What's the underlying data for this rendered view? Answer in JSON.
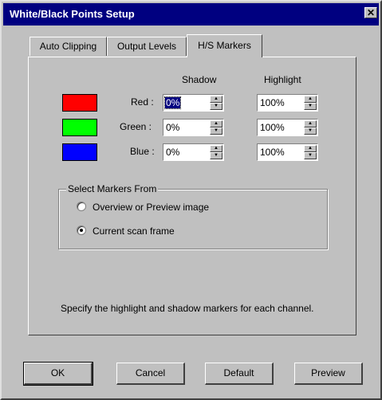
{
  "window": {
    "title": "White/Black Points Setup",
    "close_glyph": "✕"
  },
  "tabs": [
    "Auto Clipping",
    "Output Levels",
    "H/S Markers"
  ],
  "active_tab": "H/S Markers",
  "columns": {
    "shadow": "Shadow",
    "highlight": "Highlight"
  },
  "channels": [
    {
      "label": "Red :",
      "color": "#ff0000",
      "shadow": "0%",
      "highlight": "100%"
    },
    {
      "label": "Green :",
      "color": "#00ff00",
      "shadow": "0%",
      "highlight": "100%"
    },
    {
      "label": "Blue :",
      "color": "#0000ff",
      "shadow": "0%",
      "highlight": "100%"
    }
  ],
  "markers_group": {
    "title": "Select Markers From",
    "options": [
      "Overview or Preview image",
      "Current scan frame"
    ],
    "selected": "Current scan frame"
  },
  "description": "Specify the highlight and shadow markers for each channel.",
  "buttons": {
    "ok": "OK",
    "cancel": "Cancel",
    "default": "Default",
    "preview": "Preview"
  }
}
